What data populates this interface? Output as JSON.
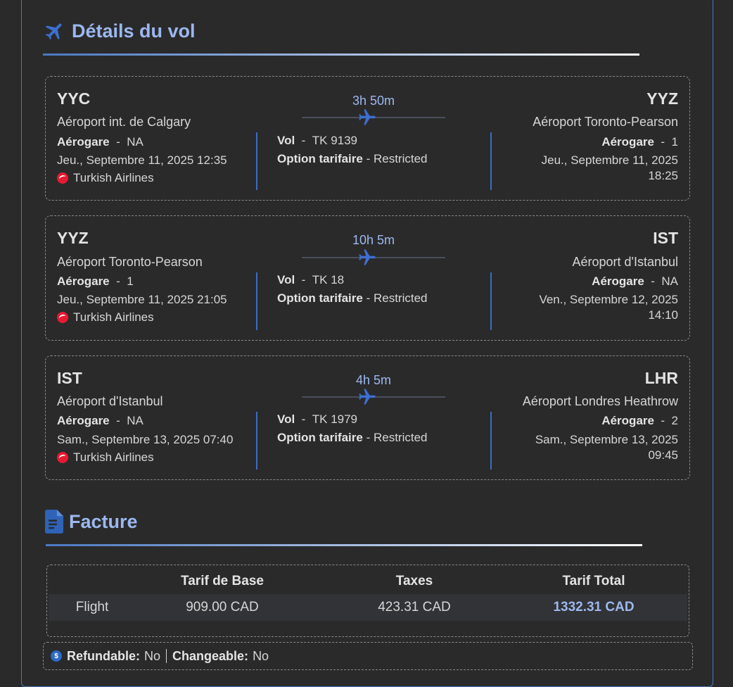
{
  "flight_details": {
    "title": "Détails du vol",
    "segments": [
      {
        "origin_code": "YYC",
        "origin_airport": "Aéroport int. de Calgary",
        "origin_terminal_label": "Aérogare",
        "origin_terminal": "NA",
        "departure": "Jeu., Septembre 11, 2025 12:35",
        "airline": "Turkish Airlines",
        "duration": "3h 50m",
        "flight_label": "Vol",
        "flight_number": "TK 9139",
        "fare_label": "Option tarifaire",
        "fare_option": "Restricted",
        "dest_code": "YYZ",
        "dest_airport": "Aéroport Toronto-Pearson",
        "dest_terminal_label": "Aérogare",
        "dest_terminal": "1",
        "arrival_date": "Jeu., Septembre 11, 2025",
        "arrival_time": "18:25"
      },
      {
        "origin_code": "YYZ",
        "origin_airport": "Aéroport Toronto-Pearson",
        "origin_terminal_label": "Aérogare",
        "origin_terminal": "1",
        "departure": "Jeu., Septembre 11, 2025 21:05",
        "airline": "Turkish Airlines",
        "duration": "10h 5m",
        "flight_label": "Vol",
        "flight_number": "TK 18",
        "fare_label": "Option tarifaire",
        "fare_option": "Restricted",
        "dest_code": "IST",
        "dest_airport": "Aéroport d'Istanbul",
        "dest_terminal_label": "Aérogare",
        "dest_terminal": "NA",
        "arrival_date": "Ven., Septembre 12, 2025",
        "arrival_time": "14:10"
      },
      {
        "origin_code": "IST",
        "origin_airport": "Aéroport d'Istanbul",
        "origin_terminal_label": "Aérogare",
        "origin_terminal": "NA",
        "departure": "Sam., Septembre 13, 2025 07:40",
        "airline": "Turkish Airlines",
        "duration": "4h 5m",
        "flight_label": "Vol",
        "flight_number": "TK 1979",
        "fare_label": "Option tarifaire",
        "fare_option": "Restricted",
        "dest_code": "LHR",
        "dest_airport": "Aéroport Londres Heathrow",
        "dest_terminal_label": "Aérogare",
        "dest_terminal": "2",
        "arrival_date": "Sam., Septembre 13, 2025",
        "arrival_time": "09:45"
      }
    ]
  },
  "invoice": {
    "title": "Facture",
    "headers": [
      "Tarif de Base",
      "Taxes",
      "Tarif Total"
    ],
    "row": {
      "label": "Flight",
      "base": "909.00 CAD",
      "taxes": "423.31 CAD",
      "total": "1332.31 CAD"
    }
  },
  "policy": {
    "refundable_label": "Refundable:",
    "refundable": "No",
    "changeable_label": "Changeable:",
    "changeable": "No"
  },
  "icons": {
    "plane": "airplane-icon",
    "invoice": "document-icon",
    "airline_logo": "turkish-airlines-logo",
    "money": "dollar-coin-icon"
  },
  "colors": {
    "accent": "#9db8ef",
    "brand_blue": "#4a78c2",
    "background": "#2a2a2b"
  }
}
